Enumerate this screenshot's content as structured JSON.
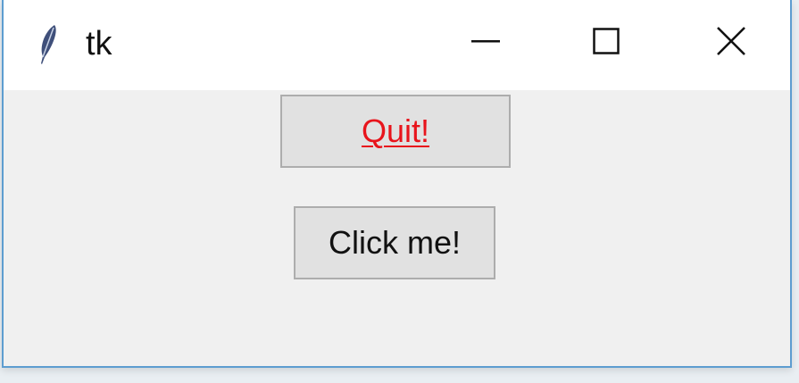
{
  "window": {
    "title": "tk",
    "icon": "feather-icon",
    "controls": {
      "minimize_icon": "minimize-icon",
      "maximize_icon": "maximize-icon",
      "close_icon": "close-icon"
    }
  },
  "buttons": {
    "quit_label": "Quit!",
    "quit_color": "#e8141c",
    "click_label": "Click me!"
  }
}
